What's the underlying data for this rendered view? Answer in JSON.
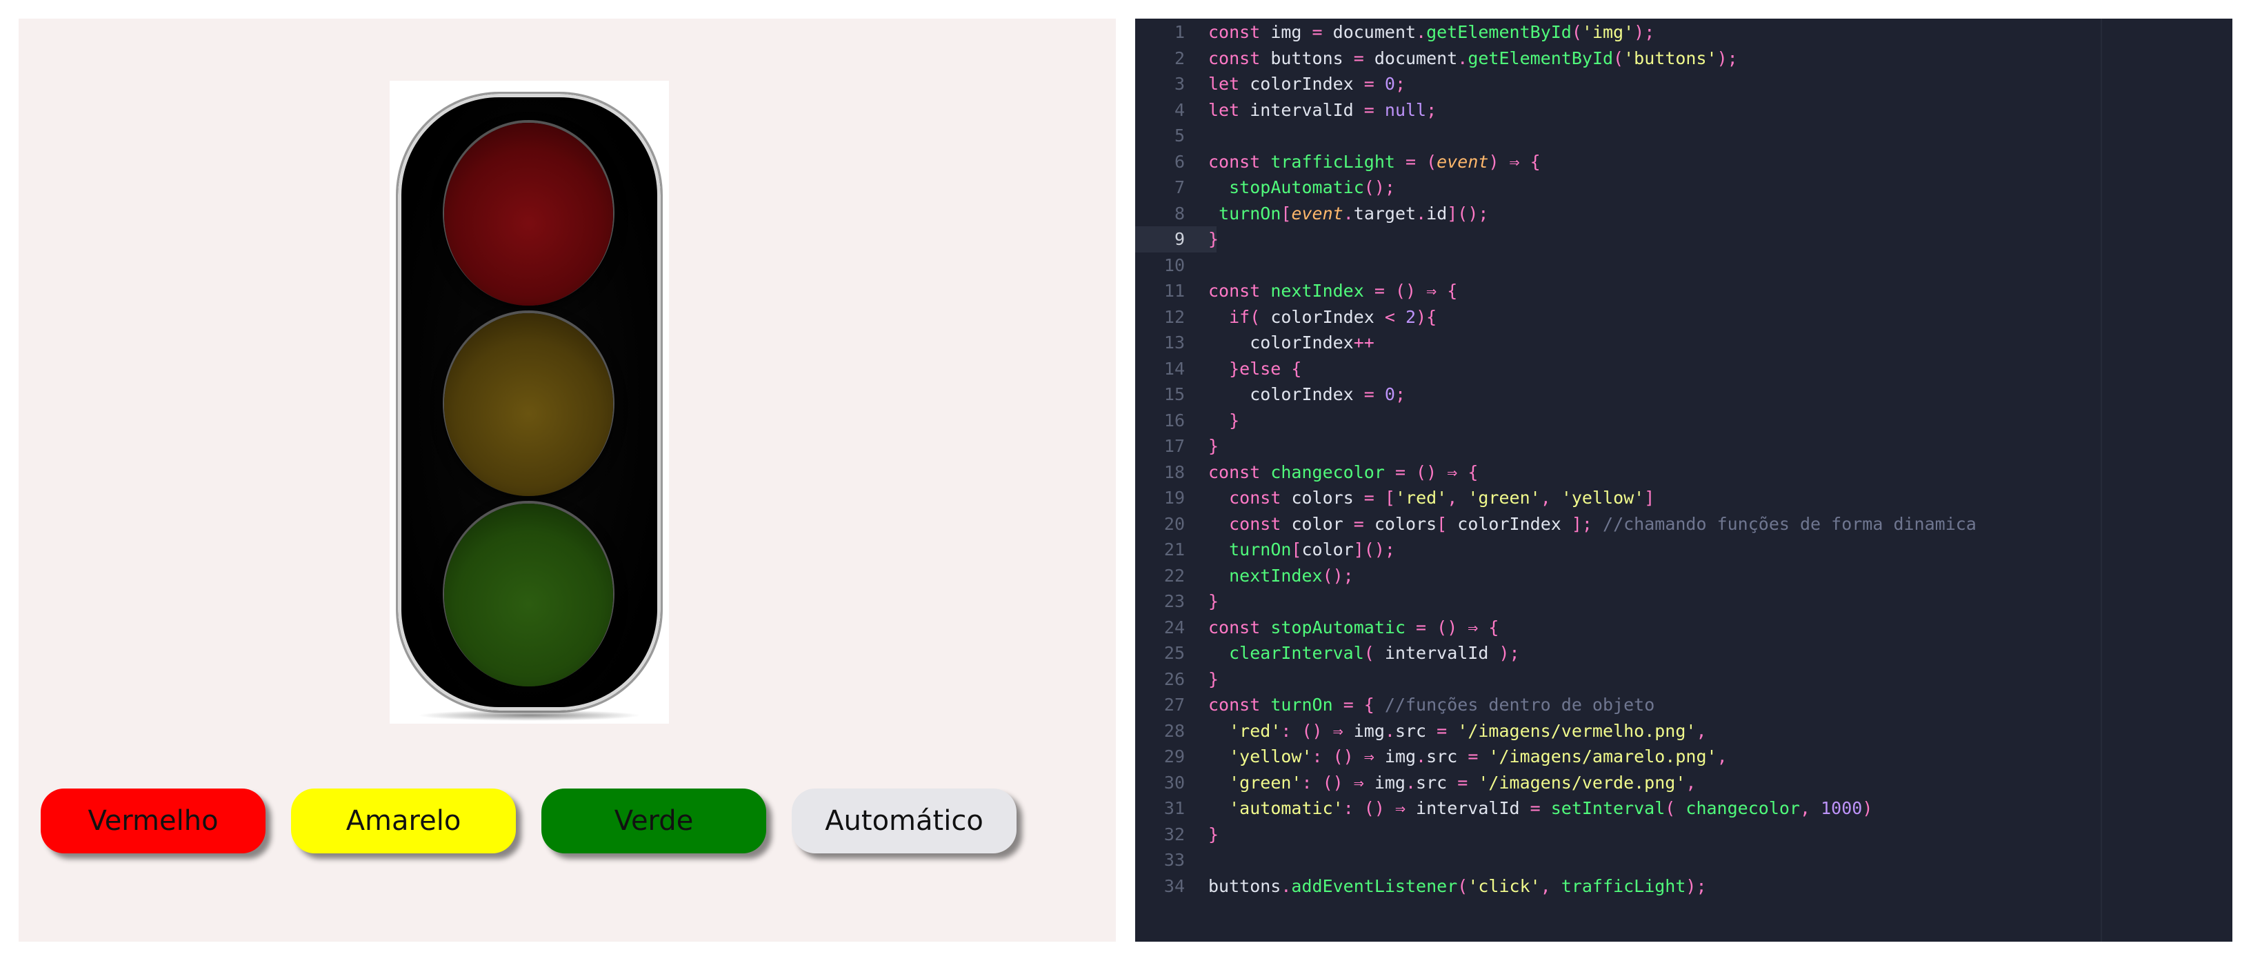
{
  "buttons": {
    "red": {
      "label": "Vermelho",
      "color": "#ff0000"
    },
    "yellow": {
      "label": "Amarelo",
      "color": "#ffff00"
    },
    "green": {
      "label": "Verde",
      "color": "#008000"
    },
    "automatic": {
      "label": "Automático",
      "color": "#e6e6ea"
    }
  },
  "editor": {
    "line_numbers": [
      "1",
      "2",
      "3",
      "4",
      "5",
      "6",
      "7",
      "8",
      "9",
      "10",
      "11",
      "12",
      "13",
      "14",
      "15",
      "16",
      "17",
      "18",
      "19",
      "20",
      "21",
      "22",
      "23",
      "24",
      "25",
      "26",
      "27",
      "28",
      "29",
      "30",
      "31",
      "32",
      "33",
      "34"
    ],
    "current_line": "9",
    "lines": [
      "const img = document.getElementById('img');",
      "const buttons = document.getElementById('buttons');",
      "let colorIndex = 0;",
      "let intervalId = null;",
      "",
      "const trafficLight = (event) ⇒ {",
      "  stopAutomatic();",
      " turnOn[event.target.id]();",
      "}",
      "",
      "const nextIndex = () ⇒ {",
      "  if( colorIndex < 2){",
      "    colorIndex++",
      "  }else {",
      "    colorIndex = 0;",
      "  }",
      "}",
      "const changecolor = () ⇒ {",
      "  const colors = ['red', 'green', 'yellow']",
      "  const color = colors[ colorIndex ]; //chamando funções de forma dinamica",
      "  turnOn[color]();",
      "  nextIndex();",
      "}",
      "const stopAutomatic = () ⇒ {",
      "  clearInterval( intervalId );",
      "}",
      "const turnOn = { //funções dentro de objeto",
      "  'red': () ⇒ img.src = '/imagens/vermelho.png',",
      "  'yellow': () ⇒ img.src = '/imagens/amarelo.png',",
      "  'green': () ⇒ img.src = '/imagens/verde.png',",
      "  'automatic': () ⇒ intervalId = setInterval( changecolor, 1000)",
      "}",
      "",
      "buttons.addEventListener('click', trafficLight);"
    ]
  }
}
